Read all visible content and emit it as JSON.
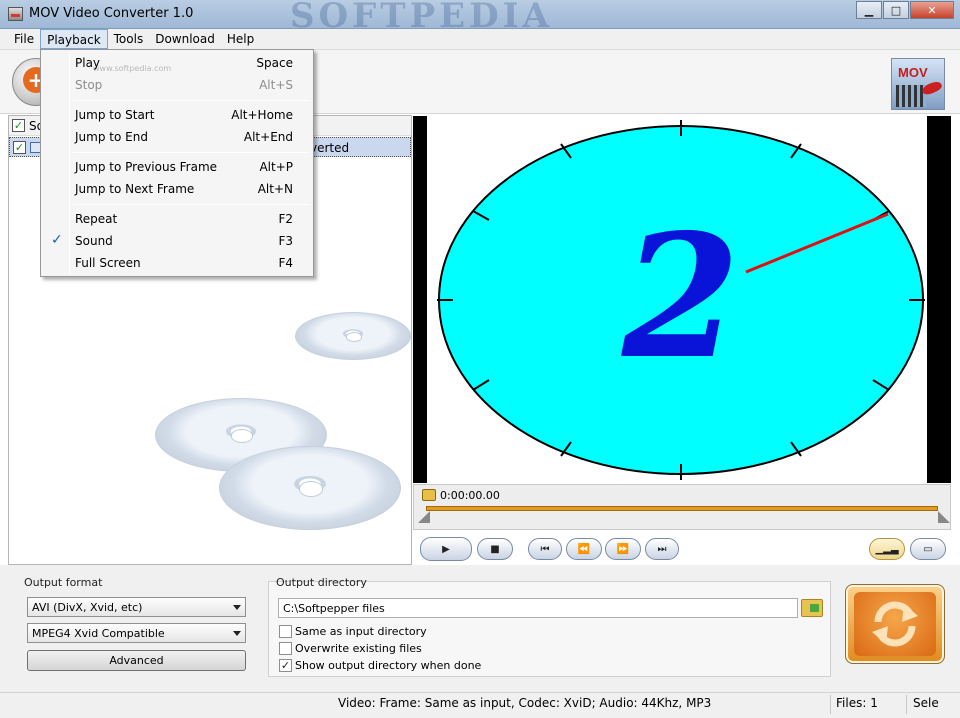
{
  "window": {
    "title": "MOV Video Converter 1.0",
    "watermark": "SOFTPEDIA"
  },
  "menubar": {
    "items": [
      "File",
      "Playback",
      "Tools",
      "Download",
      "Help"
    ]
  },
  "playback_menu": {
    "items": [
      {
        "label": "Play",
        "shortcut": "Space",
        "enabled": true,
        "checked": false
      },
      {
        "label": "Stop",
        "shortcut": "Alt+S",
        "enabled": false,
        "checked": false
      },
      {
        "label": "Jump to Start",
        "shortcut": "Alt+Home",
        "enabled": true,
        "checked": false
      },
      {
        "label": "Jump to End",
        "shortcut": "Alt+End",
        "enabled": true,
        "checked": false
      },
      {
        "label": "Jump to Previous Frame",
        "shortcut": "Alt+P",
        "enabled": true,
        "checked": false
      },
      {
        "label": "Jump to Next Frame",
        "shortcut": "Alt+N",
        "enabled": true,
        "checked": false
      },
      {
        "label": "Repeat",
        "shortcut": "F2",
        "enabled": true,
        "checked": false
      },
      {
        "label": "Sound",
        "shortcut": "F3",
        "enabled": true,
        "checked": true
      },
      {
        "label": "Full Screen",
        "shortcut": "F4",
        "enabled": true,
        "checked": false
      }
    ],
    "watermark": "www.softpedia.com",
    "checkmark": "✓"
  },
  "file_list": {
    "header_label": "So",
    "row_status": "verted",
    "check_glyph": "✓"
  },
  "video": {
    "digit": "2",
    "background_color": "#00ffff",
    "digit_color": "#0a14d8",
    "hand_color": "#e01010"
  },
  "seek": {
    "time": "0:00:00.00"
  },
  "output_format": {
    "label": "Output format",
    "format_value": "AVI (DivX, Xvid, etc)",
    "profile_value": "MPEG4 Xvid Compatible",
    "advanced_label": "Advanced"
  },
  "output_directory": {
    "label": "Output directory",
    "path": "C:\\Softpepper files",
    "options": [
      {
        "label": "Same as input directory",
        "checked": false
      },
      {
        "label": "Overwrite existing files",
        "checked": false
      },
      {
        "label": "Show output directory when done",
        "checked": true
      }
    ]
  },
  "logo": {
    "text": "MOV"
  },
  "statusbar": {
    "info": "Video: Frame: Same as input, Codec: XviD; Audio: 44Khz, MP3",
    "files": "Files: 1",
    "sel": "Sele"
  },
  "colors": {
    "accent": "#e88a1e",
    "selection": "#c9d7ef",
    "seek_bar": "#e29a21"
  }
}
